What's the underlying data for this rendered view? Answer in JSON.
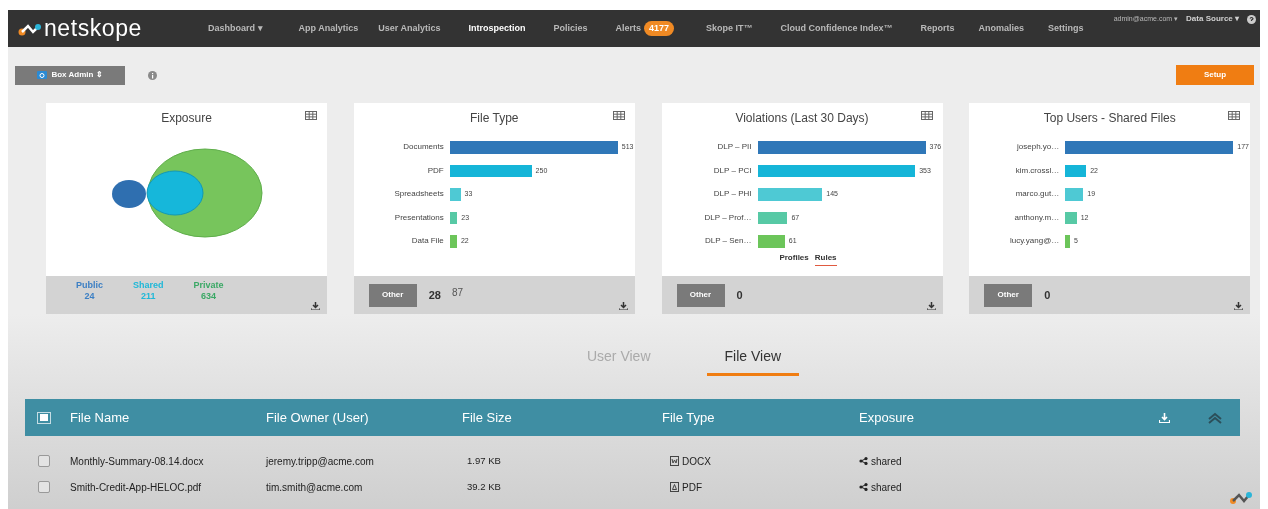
{
  "nav": {
    "logo": "netskope",
    "items": [
      {
        "label": "Dashboard ▾",
        "selected": false
      },
      {
        "label": "App Analytics",
        "selected": false
      },
      {
        "label": "User Analytics",
        "selected": false
      },
      {
        "label": "Introspection",
        "selected": true
      },
      {
        "label": "Policies",
        "selected": false
      },
      {
        "label": "Alerts",
        "selected": false,
        "badge": "4177"
      },
      {
        "label": "Skope IT™",
        "selected": false
      },
      {
        "label": "Cloud Confidence Index™",
        "selected": false
      },
      {
        "label": "Reports",
        "selected": false
      },
      {
        "label": "Anomalies",
        "selected": false
      },
      {
        "label": "Settings",
        "selected": false
      }
    ],
    "account": "admin@acme.com ▾",
    "data_source": "Data Source ▾"
  },
  "toolbar": {
    "instance": "Box Admin ⇕",
    "setup": "Setup"
  },
  "cards": [
    {
      "kind": "venn",
      "title": "Exposure",
      "legend": [
        {
          "label": "Public",
          "value": "24",
          "color": "#3b7fc4"
        },
        {
          "label": "Shared",
          "value": "211",
          "color": "#1fb8d8"
        },
        {
          "label": "Private",
          "value": "634",
          "color": "#3aa865"
        }
      ]
    },
    {
      "kind": "bar",
      "title": "File Type",
      "chart_data": {
        "type": "bar",
        "orientation": "horizontal",
        "categories": [
          "Documents",
          "PDF",
          "Spreadsheets",
          "Presentations",
          "Data File"
        ],
        "values": [
          513,
          250,
          33,
          23,
          22
        ],
        "data_labels": true
      },
      "other": "Other",
      "count": "28",
      "extra": "87"
    },
    {
      "kind": "bar",
      "title": "Violations (Last 30 Days)",
      "chart_data": {
        "type": "bar",
        "orientation": "horizontal",
        "categories": [
          "DLP – PII",
          "DLP – PCI",
          "DLP – PHI",
          "DLP – Prof…",
          "DLP – Sen…"
        ],
        "values": [
          376,
          353,
          145,
          67,
          61
        ],
        "data_labels": true
      },
      "switch": [
        {
          "label": "Profiles",
          "selected": false
        },
        {
          "label": "Rules",
          "selected": true
        }
      ],
      "other": "Other",
      "count": "0"
    },
    {
      "kind": "bar",
      "title": "Top Users - Shared Files",
      "chart_data": {
        "type": "bar",
        "orientation": "horizontal",
        "categories": [
          "joseph.yo…",
          "kim.crossl…",
          "marco.gut…",
          "anthony.m…",
          "lucy.yang@…"
        ],
        "values": [
          177,
          22,
          19,
          12,
          5
        ],
        "data_labels": true
      },
      "other": "Other",
      "count": "0"
    }
  ],
  "views": [
    {
      "label": "User View",
      "selected": false
    },
    {
      "label": "File View",
      "selected": true
    }
  ],
  "table": {
    "all_checked": false,
    "columns": [
      "File Name",
      "File Owner (User)",
      "File Size",
      "File Type",
      "Exposure"
    ],
    "rows": [
      {
        "checked": false,
        "file_name": "Monthly-Summary-08.14.docx",
        "owner": "jeremy.tripp@acme.com",
        "size": "1.97 KB",
        "type": "DOCX",
        "kind": "word",
        "exposure": "shared"
      },
      {
        "checked": false,
        "file_name": "Smith-Credit-App-HELOC.pdf",
        "owner": "tim.smith@acme.com",
        "size": "39.2 KB",
        "type": "PDF",
        "kind": "pdf",
        "exposure": "shared"
      }
    ]
  }
}
